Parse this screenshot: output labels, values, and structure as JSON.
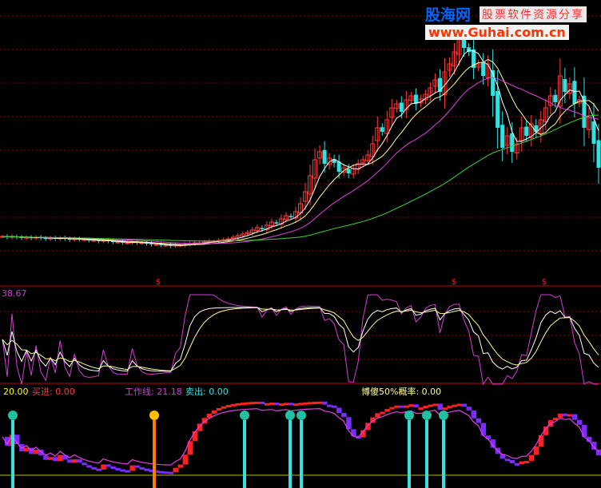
{
  "watermark": {
    "brand": "股海网",
    "slogan": "股票软件资源分享",
    "url": "www.Guhai.com.cn"
  },
  "colors": {
    "background": "#000000",
    "grid": "#8b0000",
    "up_candle": "#ff3b3b",
    "down_candle": "#35e0e0",
    "ma_short": "#ffffff",
    "ma_mid": "#ffff9a",
    "ma_long": "#e040e0",
    "ma_longest": "#40d040",
    "signal_bar": "#ff2020",
    "indicator_white": "#ffffff",
    "indicator_yellow": "#ffff9a",
    "indicator_magenta": "#d040d0",
    "lower_red": "#ff2020",
    "lower_blue": "#7a2cff",
    "lower_line": "#e040e0"
  },
  "panel2": {
    "value_label": "38.67"
  },
  "panel3": {
    "labels": [
      {
        "key": "left",
        "text": "20.00",
        "color": "#ffff00"
      },
      {
        "key": "buy",
        "text": "买进: 0.00",
        "color": "#ff3b3b"
      },
      {
        "key": "work",
        "text": "工作线: 21.18",
        "color": "#d040d0"
      },
      {
        "key": "sell",
        "text": "卖出: 0.00",
        "color": "#35e0e0"
      },
      {
        "key": "prob",
        "text": "博傻50%概率: 0.00",
        "color": "#ffff9a"
      }
    ]
  },
  "chart_data": [
    {
      "type": "candlestick",
      "series": [
        {
          "name": "price",
          "close": [
            20.4,
            20.3,
            20.4,
            20.3,
            20.2,
            20.3,
            20.2,
            20.3,
            20.2,
            20.1,
            20.2,
            20.1,
            20.2,
            20.1,
            20.0,
            20.1,
            20.0,
            20.0,
            19.9,
            19.9,
            19.8,
            19.9,
            19.8,
            19.7,
            19.7,
            19.6,
            19.6,
            19.7,
            19.6,
            19.6,
            19.5,
            19.4,
            19.4,
            19.3,
            19.3,
            19.2,
            19.3,
            19.3,
            19.4,
            19.5,
            19.6,
            19.6,
            19.7,
            19.8,
            19.8,
            19.9,
            20.0,
            20.1,
            20.3,
            20.5,
            20.7,
            20.9,
            21.2,
            21.5,
            21.3,
            21.8,
            22.2,
            22.0,
            22.6,
            23.0,
            22.8,
            23.5,
            24.5,
            26.0,
            28.0,
            30.0,
            31.0,
            29.5,
            30.2,
            29.6,
            28.5,
            29.0,
            28.3,
            28.9,
            29.5,
            30.0,
            30.6,
            32.0,
            34.0,
            33.5,
            35.0,
            36.5,
            37.0,
            36.0,
            37.5,
            38.0,
            37.0,
            37.6,
            38.2,
            39.0,
            40.0,
            38.5,
            41.0,
            42.0,
            43.5,
            45.5,
            44.0,
            43.5,
            41.5,
            42.0,
            40.5,
            42.0,
            38.0,
            34.0,
            31.5,
            33.0,
            31.0,
            32.0,
            34.0,
            33.0,
            34.5,
            33.5,
            35.0,
            36.5,
            38.0,
            37.2,
            40.5,
            38.5,
            39.5,
            37.0,
            37.5,
            34.0,
            35.5,
            32.0,
            29.0
          ]
        }
      ]
    },
    {
      "type": "line",
      "series": [
        {
          "name": "K",
          "values": []
        },
        {
          "name": "D",
          "values": []
        },
        {
          "name": "J",
          "values": []
        }
      ]
    },
    {
      "type": "bar",
      "series": [
        {
          "name": "工作线",
          "values": []
        }
      ]
    }
  ]
}
